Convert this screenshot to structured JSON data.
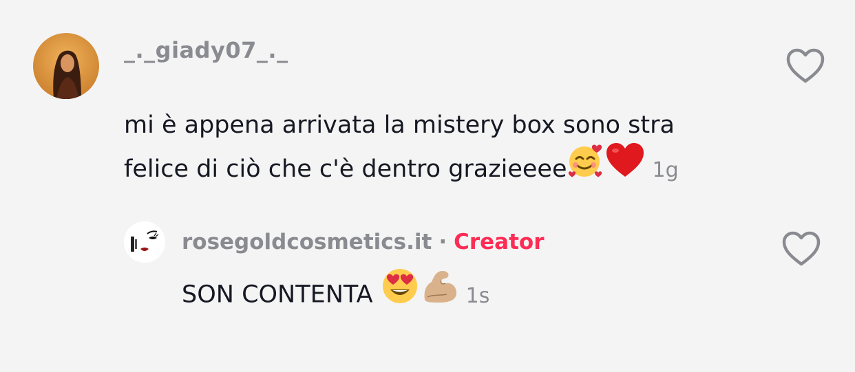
{
  "comment": {
    "username": "_._giady07_._",
    "text": "mi è appena arrivata la mistery box sono stra felice di ciò che c'è dentro grazieeee",
    "emojis": [
      "smiling-face-with-hearts",
      "red-heart"
    ],
    "time": "1g",
    "like_icon": "heart-outline-icon"
  },
  "reply": {
    "username": "rosegoldcosmetics.it",
    "separator": "·",
    "badge": "Creator",
    "text": "SON CONTENTA",
    "emojis": [
      "heart-eyes-face",
      "flexed-biceps"
    ],
    "time": "1s",
    "like_icon": "heart-outline-icon"
  },
  "colors": {
    "background": "#f4f4f4",
    "primary_text": "#161823",
    "secondary_text": "#8a8b91",
    "creator_badge": "#fe2c55"
  }
}
